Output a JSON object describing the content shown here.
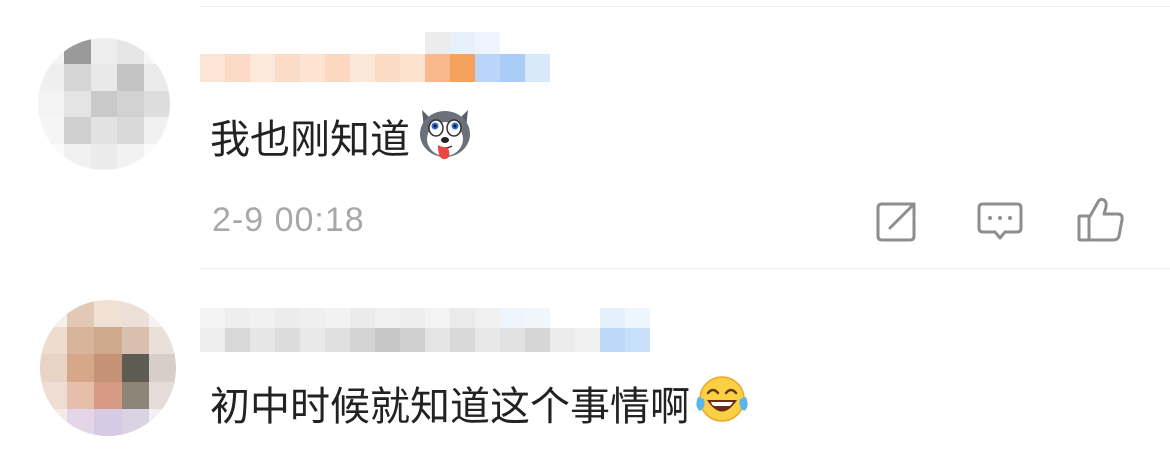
{
  "comments": [
    {
      "text": "我也刚知道",
      "emoji_icon": "husky-dog-face-emoji",
      "timestamp": "2-9 00:18",
      "actions": {
        "share_icon": "share-icon",
        "reply_icon": "comment-icon",
        "like_icon": "thumbs-up-icon"
      }
    },
    {
      "text": "初中时候就知道这个事情啊",
      "emoji_icon": "tears-of-joy-emoji"
    }
  ],
  "colors": {
    "text": "#222222",
    "timestamp": "#a8a8a8",
    "icon_gray": "#8e8e8e",
    "divider": "#ececec"
  }
}
